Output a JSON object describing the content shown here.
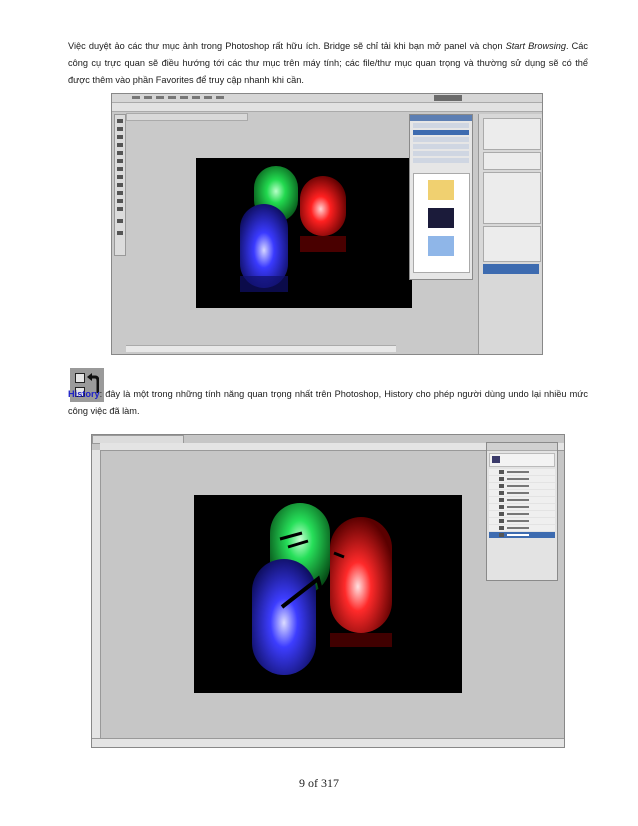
{
  "paragraph1": {
    "text_before": "Việc duyệt ảo các thư mục ảnh trong Photoshop rất hữu ích. Bridge sẽ chỉ tải khi bạn mở panel và chọn ",
    "emphasis": "Start Browsing",
    "text_after": ". Các công cụ trực quan sẽ điều hướng tới các thư mục trên máy tính; các file/thư mục quan trọng và thường sử dụng sẽ có thể được thêm vào phần Favorites để truy cập nhanh khi cần."
  },
  "paragraph2": {
    "keyword": "History",
    "text": ": đây là một trong những tính năng quan trọng nhất trên Photoshop, History cho phép người dùng undo lại nhiều mức công việc đã làm."
  },
  "page_number": "9 of 317",
  "colors": {
    "keyword": "#1f22c8",
    "led_green": "#27e05a",
    "led_red": "#ff2a2a",
    "led_blue": "#3d3dff"
  },
  "icons": {
    "history_icon": "history-panel-icon"
  }
}
